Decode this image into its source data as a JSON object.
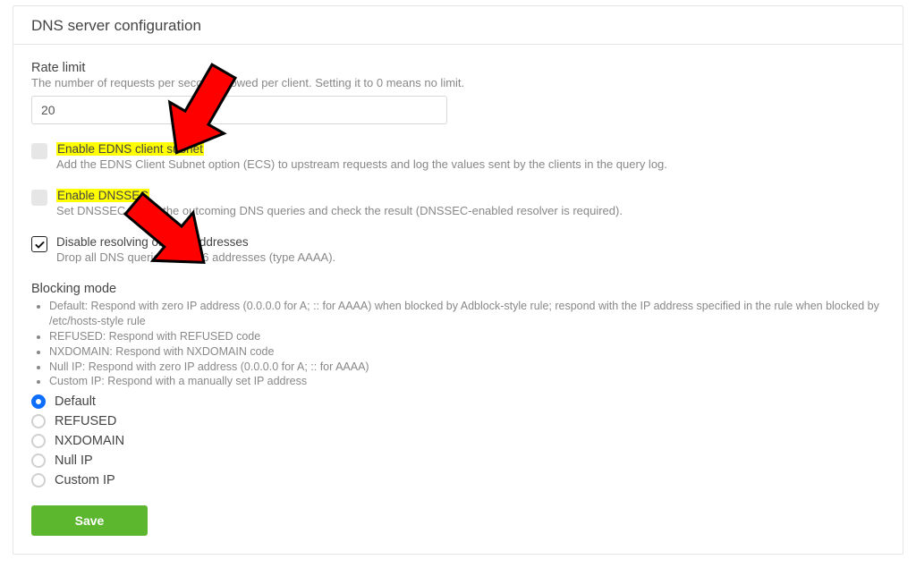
{
  "card_title": "DNS server configuration",
  "rate_limit": {
    "label": "Rate limit",
    "help": "The number of requests per second allowed per client. Setting it to 0 means no limit.",
    "value": "20"
  },
  "checks": {
    "edns": {
      "label": "Enable EDNS client subnet",
      "desc": "Add the EDNS Client Subnet option (ECS) to upstream requests and log the values sent by the clients in the query log.",
      "checked": false,
      "highlight": true
    },
    "dnssec": {
      "label": "Enable DNSSEC",
      "desc": "Set DNSSEC flag in the outcoming DNS queries and check the result (DNSSEC-enabled resolver is required).",
      "checked": false,
      "highlight": true
    },
    "disable_ipv6": {
      "label": "Disable resolving of IPv6 addresses",
      "desc": "Drop all DNS queries for IPv6 addresses (type AAAA).",
      "checked": true,
      "highlight": false
    }
  },
  "blocking": {
    "header": "Blocking mode",
    "bullets": [
      "Default: Respond with zero IP address (0.0.0.0 for A; :: for AAAA) when blocked by Adblock-style rule; respond with the IP address specified in the rule when blocked by /etc/hosts-style rule",
      "REFUSED: Respond with REFUSED code",
      "NXDOMAIN: Respond with NXDOMAIN code",
      "Null IP: Respond with zero IP address (0.0.0.0 for A; :: for AAAA)",
      "Custom IP: Respond with a manually set IP address"
    ],
    "options": [
      "Default",
      "REFUSED",
      "NXDOMAIN",
      "Null IP",
      "Custom IP"
    ],
    "selected_index": 0
  },
  "save_label": "Save"
}
